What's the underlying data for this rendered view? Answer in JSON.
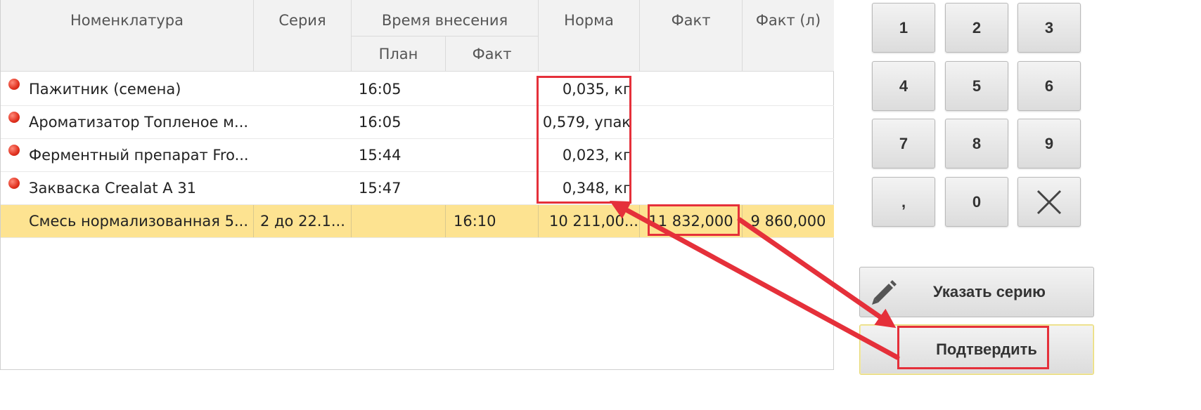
{
  "table": {
    "headers": {
      "name": "Номенклатура",
      "series": "Серия",
      "time_group": "Время внесения",
      "plan": "План",
      "fact_time": "Факт",
      "norm": "Норма",
      "fact": "Факт",
      "fact_l": "Факт (л)"
    },
    "rows": [
      {
        "status": "red",
        "name": "Пажитник (семена)",
        "series": "",
        "plan": "16:05",
        "fact_time": "",
        "norm": "0,035, кг",
        "fact": "",
        "fact_l": ""
      },
      {
        "status": "red",
        "name": "Ароматизатор Топленое м...",
        "series": "",
        "plan": "16:05",
        "fact_time": "",
        "norm": "0,579, упак",
        "fact": "",
        "fact_l": ""
      },
      {
        "status": "red",
        "name": "Ферментный препарат Fro...",
        "series": "",
        "plan": "15:44",
        "fact_time": "",
        "norm": "0,023, кг",
        "fact": "",
        "fact_l": ""
      },
      {
        "status": "red",
        "name": "Закваска Crealat A 31",
        "series": "",
        "plan": "15:47",
        "fact_time": "",
        "norm": "0,348, кг",
        "fact": "",
        "fact_l": ""
      },
      {
        "status": "",
        "name": "Смесь нормализованная 5...",
        "series": "2 до 22.1...",
        "plan": "",
        "fact_time": "16:10",
        "norm": "10 211,00...",
        "fact": "11 832,000",
        "fact_l": "9 860,000",
        "selected": true
      }
    ]
  },
  "keypad": {
    "keys": [
      "1",
      "2",
      "3",
      "4",
      "5",
      "6",
      "7",
      "8",
      "9",
      ",",
      "0"
    ],
    "clear_icon": "close-icon"
  },
  "actions": {
    "specify_series_label": "Указать серию",
    "specify_series_icon": "pencil-icon",
    "confirm_label": "Подтвердить"
  },
  "colors": {
    "selected_row": "#fde391",
    "status_red": "#e0301e",
    "annotation": "#e5303a"
  }
}
